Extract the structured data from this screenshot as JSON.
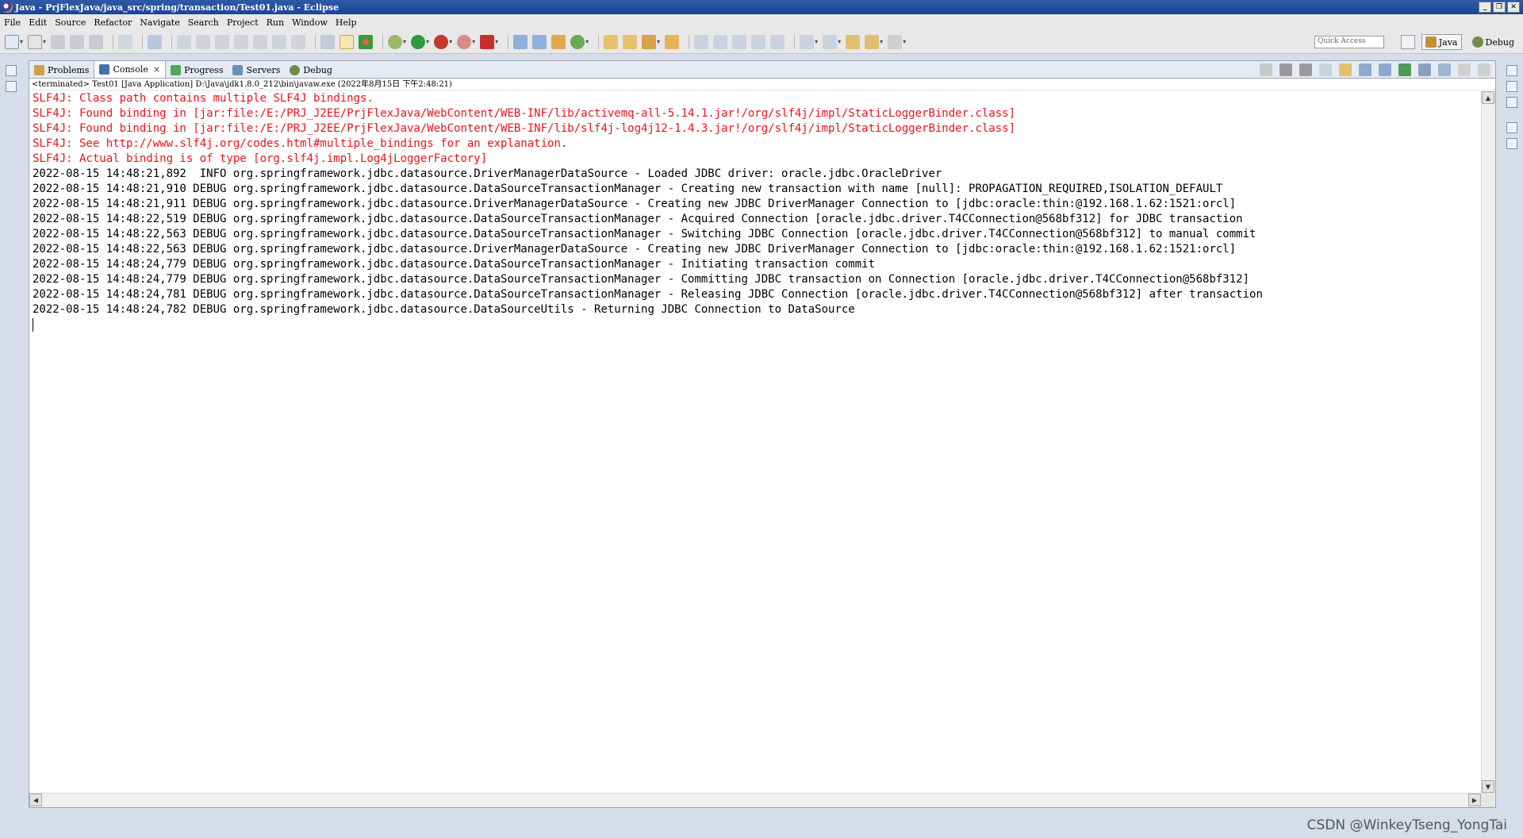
{
  "window": {
    "title": "Java - PrjFlexJava/java_src/spring/transaction/Test01.java - Eclipse",
    "buttons": [
      "_",
      "❐",
      "✕"
    ]
  },
  "menu": [
    "File",
    "Edit",
    "Source",
    "Refactor",
    "Navigate",
    "Search",
    "Project",
    "Run",
    "Window",
    "Help"
  ],
  "toolbar": {
    "quick_access_placeholder": "Quick Access",
    "perspectives": [
      {
        "label": "Java",
        "active": true
      },
      {
        "label": "Debug",
        "active": false
      }
    ]
  },
  "tabs": [
    {
      "label": "Problems",
      "active": false,
      "icon": "problems-icon"
    },
    {
      "label": "Console",
      "active": true,
      "icon": "console-icon",
      "close": "×"
    },
    {
      "label": "Progress",
      "active": false,
      "icon": "progress-icon"
    },
    {
      "label": "Servers",
      "active": false,
      "icon": "servers-icon"
    },
    {
      "label": "Debug",
      "active": false,
      "icon": "debug-icon"
    }
  ],
  "console": {
    "status": "<terminated> Test01 [Java Application] D:\\Java\\jdk1.8.0_212\\bin\\javaw.exe (2022年8月15日 下午2:48:21)",
    "lines": [
      {
        "type": "err",
        "text": "SLF4J: Class path contains multiple SLF4J bindings."
      },
      {
        "type": "err",
        "text": "SLF4J: Found binding in [jar:file:/E:/PRJ_J2EE/PrjFlexJava/WebContent/WEB-INF/lib/activemq-all-5.14.1.jar!/org/slf4j/impl/StaticLoggerBinder.class]"
      },
      {
        "type": "err",
        "text": "SLF4J: Found binding in [jar:file:/E:/PRJ_J2EE/PrjFlexJava/WebContent/WEB-INF/lib/slf4j-log4j12-1.4.3.jar!/org/slf4j/impl/StaticLoggerBinder.class]"
      },
      {
        "type": "err",
        "text": "SLF4J: See http://www.slf4j.org/codes.html#multiple_bindings for an explanation."
      },
      {
        "type": "err",
        "text": "SLF4J: Actual binding is of type [org.slf4j.impl.Log4jLoggerFactory]"
      },
      {
        "type": "out",
        "text": "2022-08-15 14:48:21,892  INFO org.springframework.jdbc.datasource.DriverManagerDataSource - Loaded JDBC driver: oracle.jdbc.OracleDriver"
      },
      {
        "type": "out",
        "text": "2022-08-15 14:48:21,910 DEBUG org.springframework.jdbc.datasource.DataSourceTransactionManager - Creating new transaction with name [null]: PROPAGATION_REQUIRED,ISOLATION_DEFAULT"
      },
      {
        "type": "out",
        "text": "2022-08-15 14:48:21,911 DEBUG org.springframework.jdbc.datasource.DriverManagerDataSource - Creating new JDBC DriverManager Connection to [jdbc:oracle:thin:@192.168.1.62:1521:orcl]"
      },
      {
        "type": "out",
        "text": "2022-08-15 14:48:22,519 DEBUG org.springframework.jdbc.datasource.DataSourceTransactionManager - Acquired Connection [oracle.jdbc.driver.T4CConnection@568bf312] for JDBC transaction"
      },
      {
        "type": "out",
        "text": "2022-08-15 14:48:22,563 DEBUG org.springframework.jdbc.datasource.DataSourceTransactionManager - Switching JDBC Connection [oracle.jdbc.driver.T4CConnection@568bf312] to manual commit"
      },
      {
        "type": "out",
        "text": "2022-08-15 14:48:22,563 DEBUG org.springframework.jdbc.datasource.DriverManagerDataSource - Creating new JDBC DriverManager Connection to [jdbc:oracle:thin:@192.168.1.62:1521:orcl]"
      },
      {
        "type": "out",
        "text": "2022-08-15 14:48:24,779 DEBUG org.springframework.jdbc.datasource.DataSourceTransactionManager - Initiating transaction commit"
      },
      {
        "type": "out",
        "text": "2022-08-15 14:48:24,779 DEBUG org.springframework.jdbc.datasource.DataSourceTransactionManager - Committing JDBC transaction on Connection [oracle.jdbc.driver.T4CConnection@568bf312]"
      },
      {
        "type": "out",
        "text": "2022-08-15 14:48:24,781 DEBUG org.springframework.jdbc.datasource.DataSourceTransactionManager - Releasing JDBC Connection [oracle.jdbc.driver.T4CConnection@568bf312] after transaction"
      },
      {
        "type": "out",
        "text": "2022-08-15 14:48:24,782 DEBUG org.springframework.jdbc.datasource.DataSourceUtils - Returning JDBC Connection to DataSource"
      }
    ]
  },
  "colors": {
    "stderr": "#e8141c",
    "stdout": "#000000",
    "titlebar": "#2e5aa8"
  },
  "watermark": "CSDN @WinkeyTseng_YongTai"
}
